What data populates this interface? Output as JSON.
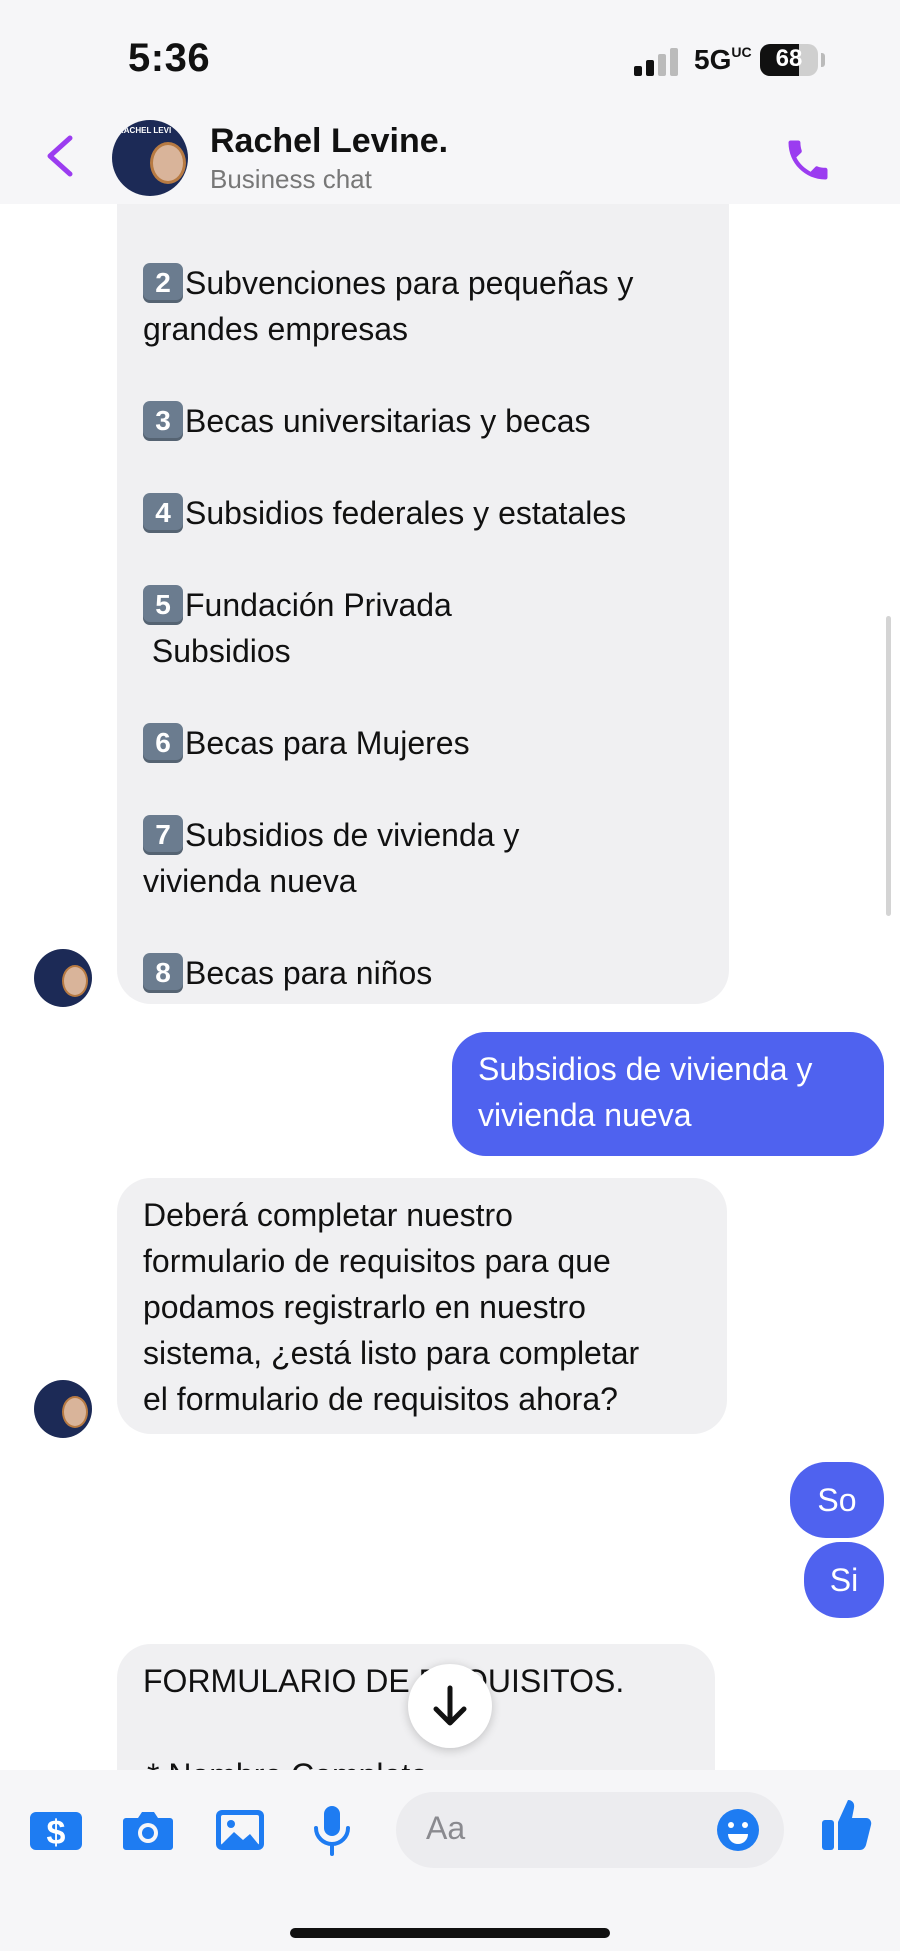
{
  "status_bar": {
    "time": "5:36",
    "network": "5G",
    "network_suffix": "UC",
    "battery": "68",
    "battery_level": 0.68
  },
  "header": {
    "contact_name": "Rachel Levine.",
    "subtitle": "Business chat",
    "avatar_text": "RACHEL LEVI"
  },
  "messages": {
    "list": [
      {
        "num": "2",
        "text": "Subvenciones para pequeñas y",
        "cont": "grandes empresas"
      },
      {
        "num": "3",
        "text": "Becas universitarias y becas",
        "cont": ""
      },
      {
        "num": "4",
        "text": "Subsidios federales y estatales",
        "cont": ""
      },
      {
        "num": "5",
        "text": "Fundación Privada",
        "cont": " Subsidios"
      },
      {
        "num": "6",
        "text": "Becas para Mujeres",
        "cont": ""
      },
      {
        "num": "7",
        "text": "Subsidios de vivienda y",
        "cont": "vivienda nueva"
      },
      {
        "num": "8",
        "text": "Becas para niños",
        "cont": ""
      }
    ],
    "reply_1": [
      "Subsidios de vivienda y",
      "vivienda nueva"
    ],
    "bot_2": [
      "Deberá completar nuestro",
      "formulario de requisitos para que",
      "podamos registrarlo en nuestro",
      "sistema, ¿está listo para completar",
      "el formulario de requisitos ahora?"
    ],
    "reply_so": "So",
    "reply_si": "Si",
    "form_title": "FORMULARIO DE REQUISITOS.",
    "form_partial": "* Nombre Completo"
  },
  "composer": {
    "placeholder": "Aa"
  },
  "colors": {
    "accent": "#9b3cf0",
    "bubble_out": "#4f62ef",
    "tool_blue": "#1e7cf2",
    "bubble_in": "#f0f0f2"
  }
}
